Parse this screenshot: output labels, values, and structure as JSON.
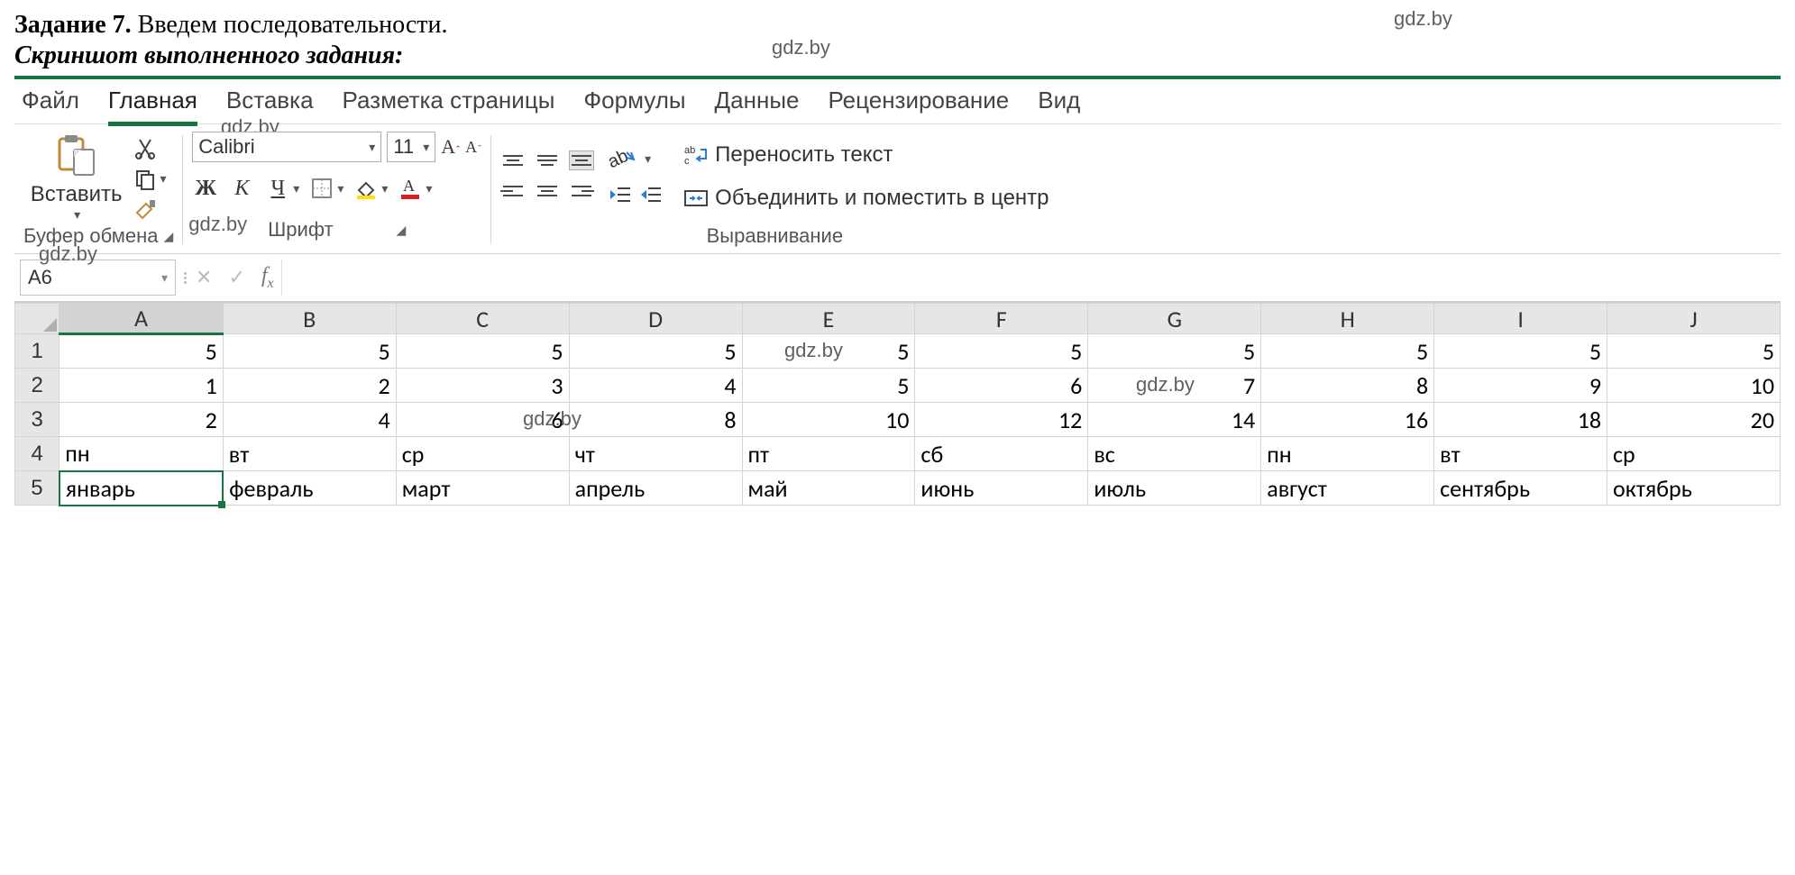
{
  "task": {
    "label": "Задание 7.",
    "text": " Введем последовательности.",
    "subtitle": "Скриншот выполненного задания:",
    "wm_right": "gdz.by",
    "wm_center": "gdz.by"
  },
  "tabs": {
    "file": "Файл",
    "home": "Главная",
    "insert": "Вставка",
    "layout": "Разметка страницы",
    "formulas": "Формулы",
    "data": "Данные",
    "review": "Рецензирование",
    "view": "Вид"
  },
  "ribbon": {
    "paste_label": "Вставить",
    "clipboard_group": "Буфер обмена",
    "font_name": "Calibri",
    "font_size": "11",
    "font_group": "Шрифт",
    "align_group": "Выравнивание",
    "wrap_text": "Переносить текст",
    "merge_center": "Объединить и поместить в центр",
    "wm_under_insert": "gdz.by",
    "wm_under_bold": "gdz.by"
  },
  "formula_bar": {
    "name_box": "A6",
    "wm_in_namebox": "gdz.by"
  },
  "columns": [
    "A",
    "B",
    "C",
    "D",
    "E",
    "F",
    "G",
    "H",
    "I",
    "J"
  ],
  "rows": {
    "r1": [
      "5",
      "5",
      "5",
      "5",
      "5",
      "5",
      "5",
      "5",
      "5",
      "5"
    ],
    "r2": [
      "1",
      "2",
      "3",
      "4",
      "5",
      "6",
      "7",
      "8",
      "9",
      "10"
    ],
    "r3": [
      "2",
      "4",
      "6",
      "8",
      "10",
      "12",
      "14",
      "16",
      "18",
      "20"
    ],
    "r4": [
      "пн",
      "вт",
      "ср",
      "чт",
      "пт",
      "сб",
      "вс",
      "пн",
      "вт",
      "ср"
    ],
    "r5": [
      "январь",
      "февраль",
      "март",
      "апрель",
      "май",
      "июнь",
      "июль",
      "август",
      "сентябрь",
      "октябрь"
    ]
  },
  "grid_wm": {
    "f1": "gdz.by",
    "d3": "gdz.by",
    "i2": "gdz.by"
  },
  "row_labels": [
    "1",
    "2",
    "3",
    "4",
    "5"
  ]
}
